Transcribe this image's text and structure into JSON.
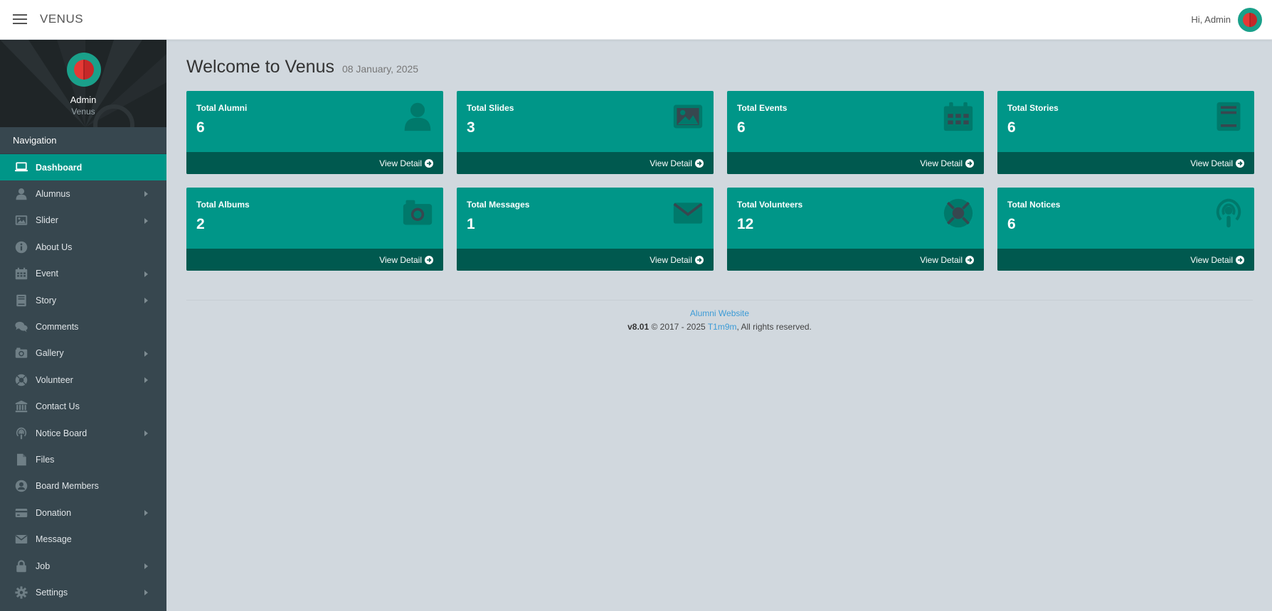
{
  "topbar": {
    "brand": "VENUS",
    "greeting": "Hi, Admin"
  },
  "profile": {
    "name": "Admin",
    "role": "Venus"
  },
  "nav": {
    "header": "Navigation",
    "items": [
      {
        "label": "Dashboard",
        "icon": "laptop-icon",
        "active": true,
        "submenu": false
      },
      {
        "label": "Alumnus",
        "icon": "user-icon",
        "submenu": true
      },
      {
        "label": "Slider",
        "icon": "image-icon",
        "submenu": true
      },
      {
        "label": "About Us",
        "icon": "info-icon",
        "submenu": false
      },
      {
        "label": "Event",
        "icon": "calendar-icon",
        "submenu": true
      },
      {
        "label": "Story",
        "icon": "book-icon",
        "submenu": true
      },
      {
        "label": "Comments",
        "icon": "comments-icon",
        "submenu": false
      },
      {
        "label": "Gallery",
        "icon": "camera-icon",
        "submenu": true
      },
      {
        "label": "Volunteer",
        "icon": "lifebuoy-icon",
        "submenu": true
      },
      {
        "label": "Contact Us",
        "icon": "bank-icon",
        "submenu": false
      },
      {
        "label": "Notice Board",
        "icon": "podcast-icon",
        "submenu": true
      },
      {
        "label": "Files",
        "icon": "file-icon",
        "submenu": false
      },
      {
        "label": "Board Members",
        "icon": "user-circle-icon",
        "submenu": false
      },
      {
        "label": "Donation",
        "icon": "credit-card-icon",
        "submenu": true
      },
      {
        "label": "Message",
        "icon": "envelope-icon",
        "submenu": false
      },
      {
        "label": "Job",
        "icon": "lock-icon",
        "submenu": true
      },
      {
        "label": "Settings",
        "icon": "gear-icon",
        "submenu": true
      }
    ]
  },
  "main": {
    "welcome": "Welcome to Venus",
    "date": "08 January, 2025",
    "cards": [
      {
        "title": "Total Alumni",
        "value": "6",
        "icon": "user-icon",
        "link": "View Detail"
      },
      {
        "title": "Total Slides",
        "value": "3",
        "icon": "image-icon",
        "link": "View Detail"
      },
      {
        "title": "Total Events",
        "value": "6",
        "icon": "calendar-icon",
        "link": "View Detail"
      },
      {
        "title": "Total Stories",
        "value": "6",
        "icon": "book-icon",
        "link": "View Detail"
      },
      {
        "title": "Total Albums",
        "value": "2",
        "icon": "camera-icon",
        "link": "View Detail"
      },
      {
        "title": "Total Messages",
        "value": "1",
        "icon": "envelope-icon",
        "link": "View Detail"
      },
      {
        "title": "Total Volunteers",
        "value": "12",
        "icon": "lifebuoy-icon",
        "link": "View Detail"
      },
      {
        "title": "Total Notices",
        "value": "6",
        "icon": "podcast-icon",
        "link": "View Detail"
      }
    ]
  },
  "footer": {
    "site_link": "Alumni Website",
    "version": "v8.01",
    "copyright_pre": " © 2017 - 2025 ",
    "author": "T1m9m",
    "rights": ", All rights reserved."
  },
  "colors": {
    "accent": "#009688",
    "accent_dark": "#00594f",
    "sidebar": "#37474f",
    "background": "#d1d8de"
  }
}
